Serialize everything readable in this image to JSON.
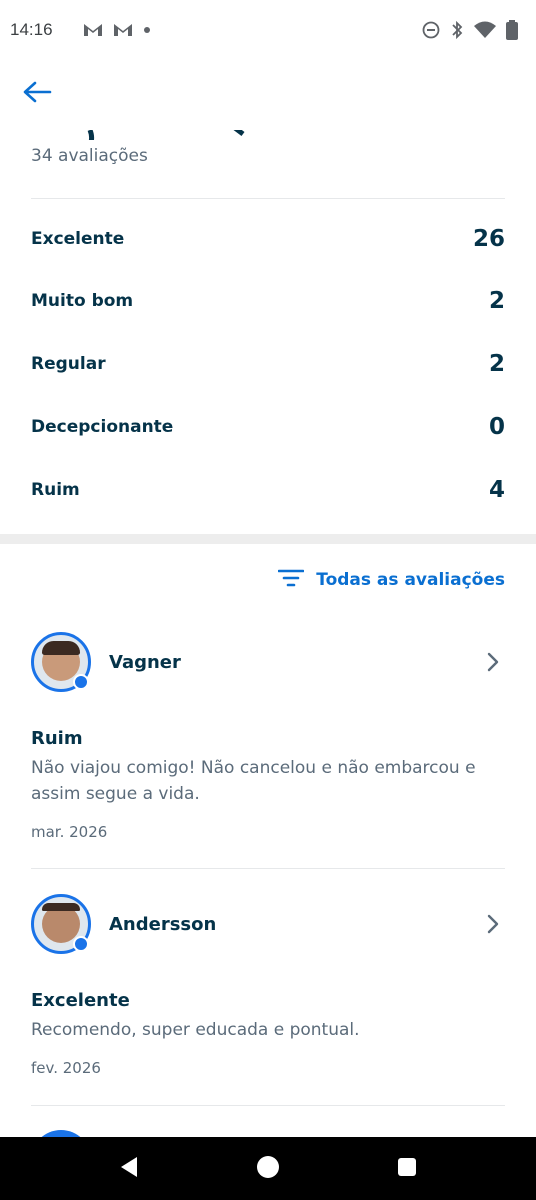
{
  "status_bar": {
    "time": "14:16",
    "icons": [
      "gmail-icon",
      "gmail-icon",
      "dot-icon",
      "dnd-icon",
      "bluetooth-icon",
      "wifi-icon",
      "battery-icon"
    ]
  },
  "summary": {
    "reviews_count": "34 avaliações"
  },
  "ratings": [
    {
      "label": "Excelente",
      "count": "26"
    },
    {
      "label": "Muito bom",
      "count": "2"
    },
    {
      "label": "Regular",
      "count": "2"
    },
    {
      "label": "Decepcionante",
      "count": "0"
    },
    {
      "label": "Ruim",
      "count": "4"
    }
  ],
  "filter": {
    "label": "Todas as avaliações"
  },
  "reviews": [
    {
      "name": "Vagner",
      "rating": "Ruim",
      "text": "Não viajou comigo! Não cancelou e não embarcou e assim segue a vida.",
      "date": "mar. 2026"
    },
    {
      "name": "Andersson",
      "rating": "Excelente",
      "text": "Recomendo, super educada e pontual.",
      "date": "fev. 2026"
    }
  ],
  "colors": {
    "accent": "#0a6fd1",
    "text_dark": "#053349",
    "text_muted": "#5b6b7a"
  }
}
